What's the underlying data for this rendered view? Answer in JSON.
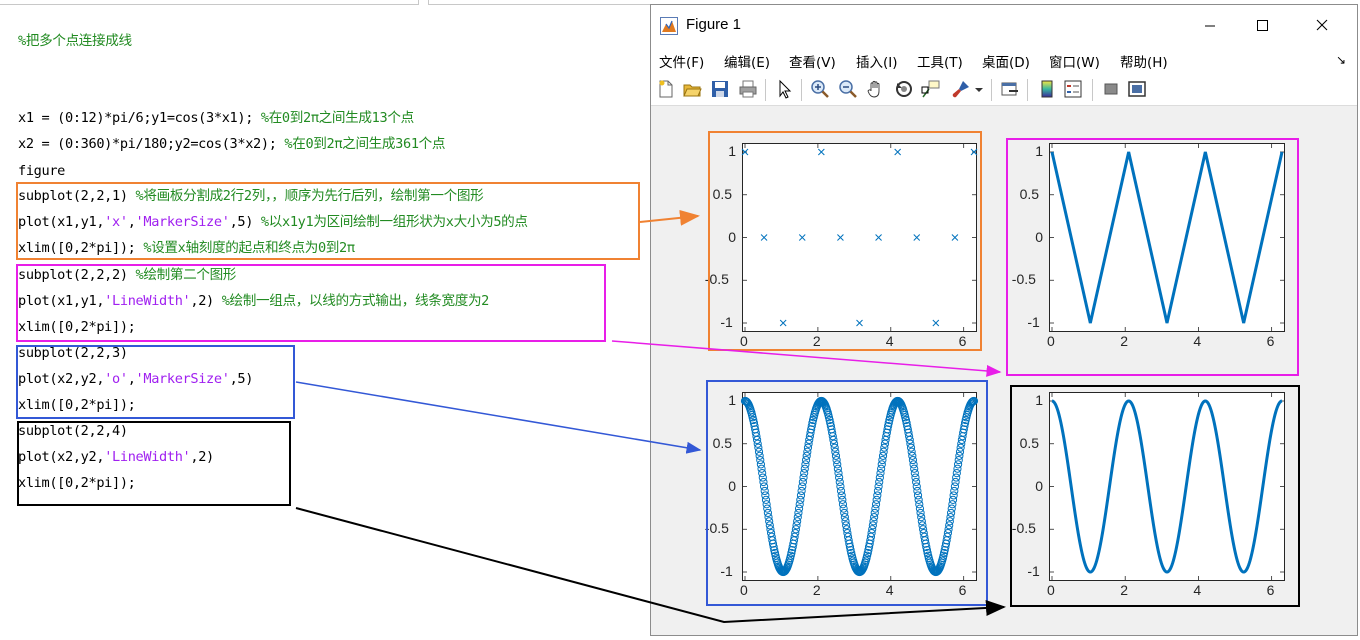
{
  "code": [
    {
      "id": "l1",
      "parts": [
        {
          "t": "%把多个点连接成线",
          "c": "cm"
        }
      ]
    },
    {
      "id": "l2",
      "parts": [
        {
          "t": "x1 = (0:12)*pi/6;y1=cos(3*x1); ",
          "c": ""
        },
        {
          "t": "%在0到2π之间生成13个点",
          "c": "cm"
        }
      ]
    },
    {
      "id": "l3",
      "parts": [
        {
          "t": "x2 = (0:360)*pi/180;y2=cos(3*x2); ",
          "c": ""
        },
        {
          "t": "%在0到2π之间生成361个点",
          "c": "cm"
        }
      ]
    },
    {
      "id": "l4",
      "parts": [
        {
          "t": "figure",
          "c": ""
        }
      ]
    },
    {
      "id": "l5",
      "parts": [
        {
          "t": "subplot(2,2,1) ",
          "c": ""
        },
        {
          "t": "%将画板分割成2行2列，，顺序为先行后列，绘制第一个图形",
          "c": "cm"
        }
      ]
    },
    {
      "id": "l6",
      "parts": [
        {
          "t": "plot(x1,y1,",
          "c": ""
        },
        {
          "t": "'x'",
          "c": "st"
        },
        {
          "t": ",",
          "c": ""
        },
        {
          "t": "'MarkerSize'",
          "c": "st"
        },
        {
          "t": ",5) ",
          "c": ""
        },
        {
          "t": "%以x1y1为区间绘制一组形状为x大小为5的点",
          "c": "cm"
        }
      ]
    },
    {
      "id": "l7",
      "parts": [
        {
          "t": "xlim([0,2*pi]); ",
          "c": ""
        },
        {
          "t": "%设置x轴刻度的起点和终点为0到2π",
          "c": "cm"
        }
      ]
    },
    {
      "id": "l8",
      "parts": [
        {
          "t": "subplot(2,2,2) ",
          "c": ""
        },
        {
          "t": "%绘制第二个图形",
          "c": "cm"
        }
      ]
    },
    {
      "id": "l9",
      "parts": [
        {
          "t": "plot(x1,y1,",
          "c": ""
        },
        {
          "t": "'LineWidth'",
          "c": "st"
        },
        {
          "t": ",2) ",
          "c": ""
        },
        {
          "t": "%绘制一组点，以线的方式输出，线条宽度为2",
          "c": "cm"
        }
      ]
    },
    {
      "id": "l10",
      "parts": [
        {
          "t": "xlim([0,2*pi]);",
          "c": ""
        }
      ]
    },
    {
      "id": "l11",
      "parts": [
        {
          "t": "subplot(2,2,3)",
          "c": ""
        }
      ]
    },
    {
      "id": "l12",
      "parts": [
        {
          "t": "plot(x2,y2,",
          "c": ""
        },
        {
          "t": "'o'",
          "c": "st"
        },
        {
          "t": ",",
          "c": ""
        },
        {
          "t": "'MarkerSize'",
          "c": "st"
        },
        {
          "t": ",5)",
          "c": ""
        }
      ]
    },
    {
      "id": "l13",
      "parts": [
        {
          "t": "xlim([0,2*pi]);",
          "c": ""
        }
      ]
    },
    {
      "id": "l14",
      "parts": [
        {
          "t": "subplot(2,2,4)",
          "c": ""
        }
      ]
    },
    {
      "id": "l15",
      "parts": [
        {
          "t": "plot(x2,y2,",
          "c": ""
        },
        {
          "t": "'LineWidth'",
          "c": "st"
        },
        {
          "t": ",2)",
          "c": ""
        }
      ]
    },
    {
      "id": "l16",
      "parts": [
        {
          "t": "xlim([0,2*pi]);",
          "c": ""
        }
      ]
    }
  ],
  "window": {
    "title": "Figure 1",
    "minimize_glyph": "—",
    "maximize_glyph": "☐",
    "close_glyph": "✕",
    "menu_items": [
      "文件(F)",
      "编辑(E)",
      "查看(V)",
      "插入(I)",
      "工具(T)",
      "桌面(D)",
      "窗口(W)",
      "帮助(H)"
    ],
    "dock_glyph": "↘",
    "toolbar_icons": [
      "new-figure-icon",
      "open-file-icon",
      "save-icon",
      "print-icon",
      "pointer-icon",
      "zoom-in-icon",
      "zoom-out-icon",
      "pan-hand-icon",
      "rotate-3d-icon",
      "data-cursor-icon",
      "brush-icon",
      "brush-dropdown-icon",
      "link-plot-icon",
      "colorbar-icon",
      "legend-icon",
      "hide-plot-tools-icon",
      "show-plot-tools-icon"
    ]
  },
  "colors": {
    "plot_blue": "#0072bd",
    "comment_green": "#228b22",
    "string_purple": "#a020f0",
    "box_orange": "#f08232",
    "box_magenta": "#e81ee8",
    "box_blue": "#3358d6",
    "box_black": "#000000"
  },
  "chart_data": [
    {
      "type": "scatter",
      "subplot": "2,2,1",
      "marker": "x",
      "series": "x1,y1",
      "x": "(0:12)*pi/6",
      "function": "cos(3*x)",
      "n_points": 13,
      "xlim": [
        0,
        6.2832
      ],
      "ylim": [
        -1,
        1
      ],
      "xticks": [
        "0",
        "2",
        "4",
        "6"
      ],
      "yticks": [
        "1",
        "0.5",
        "0",
        "-0.5",
        "-1"
      ]
    },
    {
      "type": "line",
      "subplot": "2,2,2",
      "line_width": 2,
      "series": "x1,y1",
      "x": "(0:12)*pi/6",
      "function": "cos(3*x)",
      "n_points": 13,
      "xlim": [
        0,
        6.2832
      ],
      "ylim": [
        -1,
        1
      ],
      "xticks": [
        "0",
        "2",
        "4",
        "6"
      ],
      "yticks": [
        "1",
        "0.5",
        "0",
        "-0.5",
        "-1"
      ]
    },
    {
      "type": "scatter",
      "subplot": "2,2,3",
      "marker": "o",
      "series": "x2,y2",
      "x": "(0:360)*pi/180",
      "function": "cos(3*x)",
      "n_points": 361,
      "xlim": [
        0,
        6.2832
      ],
      "ylim": [
        -1,
        1
      ],
      "xticks": [
        "0",
        "2",
        "4",
        "6"
      ],
      "yticks": [
        "1",
        "0.5",
        "0",
        "-0.5",
        "-1"
      ]
    },
    {
      "type": "line",
      "subplot": "2,2,4",
      "line_width": 2,
      "series": "x2,y2",
      "x": "(0:360)*pi/180",
      "function": "cos(3*x)",
      "n_points": 361,
      "xlim": [
        0,
        6.2832
      ],
      "ylim": [
        -1,
        1
      ],
      "xticks": [
        "0",
        "2",
        "4",
        "6"
      ],
      "yticks": [
        "1",
        "0.5",
        "0",
        "-0.5",
        "-1"
      ]
    }
  ]
}
